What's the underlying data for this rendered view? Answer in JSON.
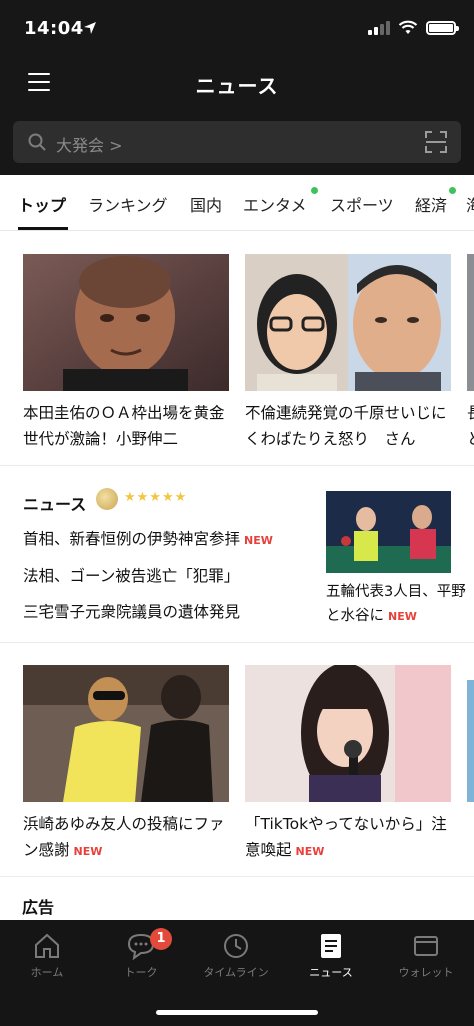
{
  "status": {
    "time": "14:04"
  },
  "header": {
    "title": "ニュース"
  },
  "search": {
    "text": "大発会 >"
  },
  "tabs": [
    {
      "label": "トップ",
      "active": true,
      "dot": false
    },
    {
      "label": "ランキング",
      "active": false,
      "dot": false
    },
    {
      "label": "国内",
      "active": false,
      "dot": false
    },
    {
      "label": "エンタメ",
      "active": false,
      "dot": true
    },
    {
      "label": "スポーツ",
      "active": false,
      "dot": false
    },
    {
      "label": "経済",
      "active": false,
      "dot": true
    },
    {
      "label": "海",
      "active": false,
      "dot": false
    }
  ],
  "featured": [
    {
      "title": "本田圭佑のＯＡ枠出場を黄金世代が激論！小野伸二"
    },
    {
      "title": "不倫連続発覚の千原せいじにくわばたりえ怒り　さん"
    },
    {
      "title": "長と"
    }
  ],
  "news_section": {
    "heading": "ニュース",
    "stars": "★★★★★",
    "headlines": [
      {
        "text": "首相、新春恒例の伊勢神宮参拝",
        "new": "NEW"
      },
      {
        "text": "法相、ゴーン被告逃亡「犯罪」",
        "new": ""
      },
      {
        "text": "三宅雪子元衆院議員の遺体発見",
        "new": ""
      }
    ],
    "side": {
      "title": "五輪代表3人目、平野と水谷に",
      "new": "NEW"
    }
  },
  "second_row": [
    {
      "title": "浜崎あゆみ友人の投稿にファン感謝",
      "new": "NEW"
    },
    {
      "title": "「TikTokやってないから」注意喚起",
      "new": "NEW"
    }
  ],
  "ad": {
    "label": "広告"
  },
  "bottom_nav": [
    {
      "label": "ホーム",
      "icon": "home-icon",
      "active": false
    },
    {
      "label": "トーク",
      "icon": "chat-icon",
      "active": false,
      "badge": "1"
    },
    {
      "label": "タイムライン",
      "icon": "clock-icon",
      "active": false
    },
    {
      "label": "ニュース",
      "icon": "news-icon",
      "active": true
    },
    {
      "label": "ウォレット",
      "icon": "wallet-icon",
      "active": false
    }
  ],
  "colors": {
    "accent_new": "#e8413b",
    "dot": "#3fc15b",
    "dark_bg": "#171717"
  }
}
